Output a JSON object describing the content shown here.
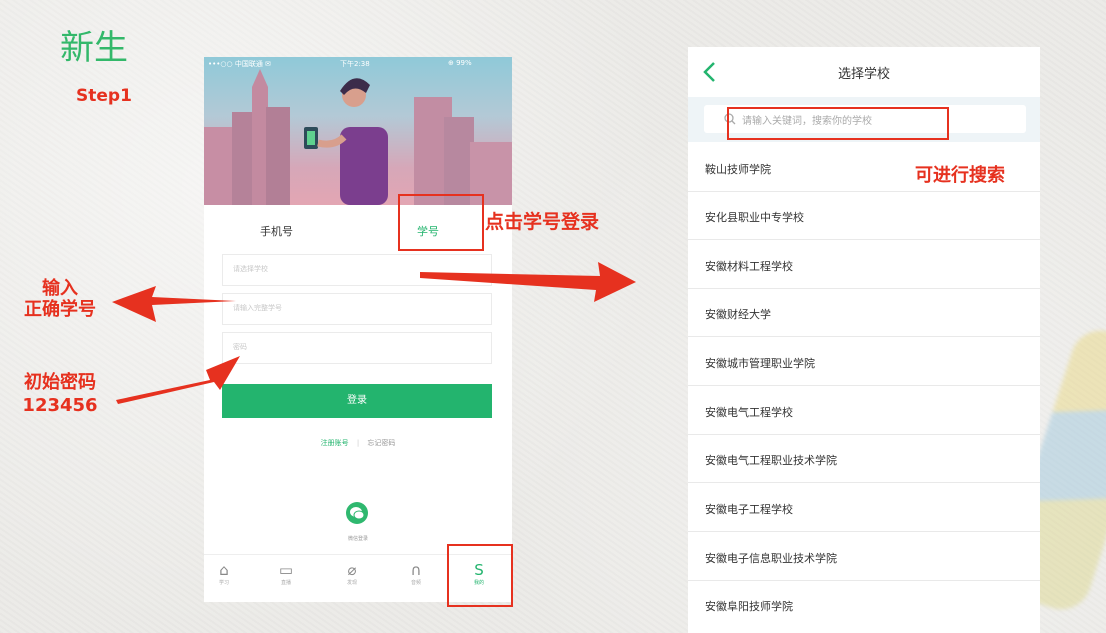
{
  "left": {
    "title": "新生",
    "step": "Step1",
    "annot_click_student_id": "点击学号登录",
    "annot_input_line1": "输入",
    "annot_input_line2": "正确学号",
    "annot_password_line1": "初始密码",
    "annot_password_line2": "123456"
  },
  "phone": {
    "status": {
      "carrier": "•••○○ 中国联通 ✉",
      "time": "下午2:38",
      "battery": "⊕ 99%"
    },
    "tabs": {
      "phone": "手机号",
      "student_id": "学号"
    },
    "fields": {
      "school_placeholder": "请选择学校",
      "student_id_placeholder": "请输入完整学号",
      "password_placeholder": "密码"
    },
    "login_label": "登录",
    "links": {
      "register": "注册账号",
      "separator": "|",
      "forgot": "忘记密码"
    },
    "wechat_label": "微信登录",
    "bottom_nav": [
      {
        "icon": "graduation-cap-icon",
        "glyph": "⌂",
        "label": "学习"
      },
      {
        "icon": "video-icon",
        "glyph": "▭",
        "label": "直播"
      },
      {
        "icon": "compass-icon",
        "glyph": "⌀",
        "label": "发现"
      },
      {
        "icon": "headphones-icon",
        "glyph": "∩",
        "label": "音频"
      },
      {
        "icon": "profile-s-icon",
        "glyph": "S",
        "label": "我的"
      }
    ]
  },
  "school_list": {
    "title": "选择学校",
    "search_placeholder": "请输入关键词，搜索你的学校",
    "search_annot": "可进行搜索",
    "schools": [
      "鞍山技师学院",
      "安化县职业中专学校",
      "安徽材料工程学校",
      "安徽财经大学",
      "安徽城市管理职业学院",
      "安徽电气工程学校",
      "安徽电气工程职业技术学院",
      "安徽电子工程学校",
      "安徽电子信息职业技术学院",
      "安徽阜阳技师学院"
    ]
  },
  "colors": {
    "accent_green": "#23b46e",
    "annotation_red": "#e6311f",
    "title_green": "#33b86a"
  }
}
